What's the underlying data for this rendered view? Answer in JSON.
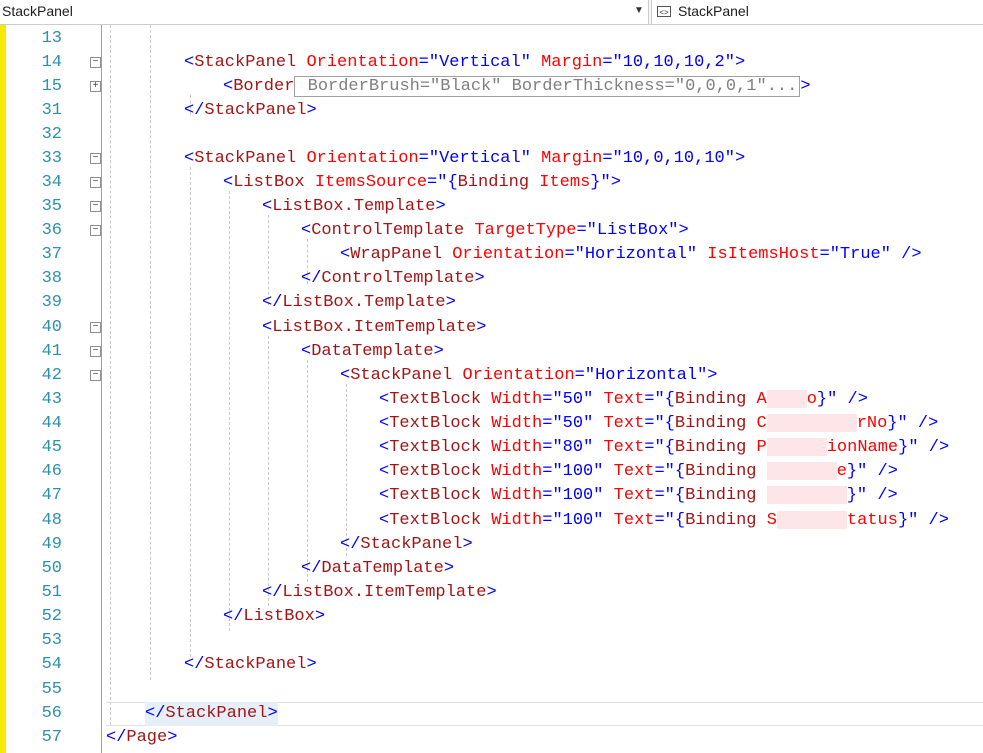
{
  "toolbar": {
    "left_combo": "StackPanel",
    "right_combo": "StackPanel"
  },
  "lines": [
    {
      "n": "13",
      "code": ""
    },
    {
      "n": "14",
      "code": "<StackPanel Orientation=\"Vertical\" Margin=\"10,10,10,2\">"
    },
    {
      "n": "15",
      "code": "<Border BorderBrush=\"Black\" BorderThickness=\"0,0,0,1\"...>"
    },
    {
      "n": "31",
      "code": "</StackPanel>"
    },
    {
      "n": "32",
      "code": ""
    },
    {
      "n": "33",
      "code": "<StackPanel Orientation=\"Vertical\" Margin=\"10,0,10,10\">"
    },
    {
      "n": "34",
      "code": "<ListBox ItemsSource=\"{Binding Items}\">"
    },
    {
      "n": "35",
      "code": "<ListBox.Template>"
    },
    {
      "n": "36",
      "code": "<ControlTemplate TargetType=\"ListBox\">"
    },
    {
      "n": "37",
      "code": "<WrapPanel Orientation=\"Horizontal\" IsItemsHost=\"True\" />"
    },
    {
      "n": "38",
      "code": "</ControlTemplate>"
    },
    {
      "n": "39",
      "code": "</ListBox.Template>"
    },
    {
      "n": "40",
      "code": "<ListBox.ItemTemplate>"
    },
    {
      "n": "41",
      "code": "<DataTemplate>"
    },
    {
      "n": "42",
      "code": "<StackPanel Orientation=\"Horizontal\">"
    },
    {
      "n": "43",
      "code": "<TextBlock Width=\"50\" Text=\"{Binding A o}\" />"
    },
    {
      "n": "44",
      "code": "<TextBlock Width=\"50\" Text=\"{Binding C rNo}\" />"
    },
    {
      "n": "45",
      "code": "<TextBlock Width=\"80\" Text=\"{Binding P ionName}\" />"
    },
    {
      "n": "46",
      "code": "<TextBlock Width=\"100\" Text=\"{Binding e}\" />"
    },
    {
      "n": "47",
      "code": "<TextBlock Width=\"100\" Text=\"{Binding }\" />"
    },
    {
      "n": "48",
      "code": "<TextBlock Width=\"100\" Text=\"{Binding S tatus}\" />"
    },
    {
      "n": "49",
      "code": "</StackPanel>"
    },
    {
      "n": "50",
      "code": "</DataTemplate>"
    },
    {
      "n": "51",
      "code": "</ListBox.ItemTemplate>"
    },
    {
      "n": "52",
      "code": "</ListBox>"
    },
    {
      "n": "53",
      "code": ""
    },
    {
      "n": "54",
      "code": "</StackPanel>"
    },
    {
      "n": "55",
      "code": ""
    },
    {
      "n": "56",
      "code": "</StackPanel>"
    },
    {
      "n": "57",
      "code": "</Page>"
    }
  ]
}
